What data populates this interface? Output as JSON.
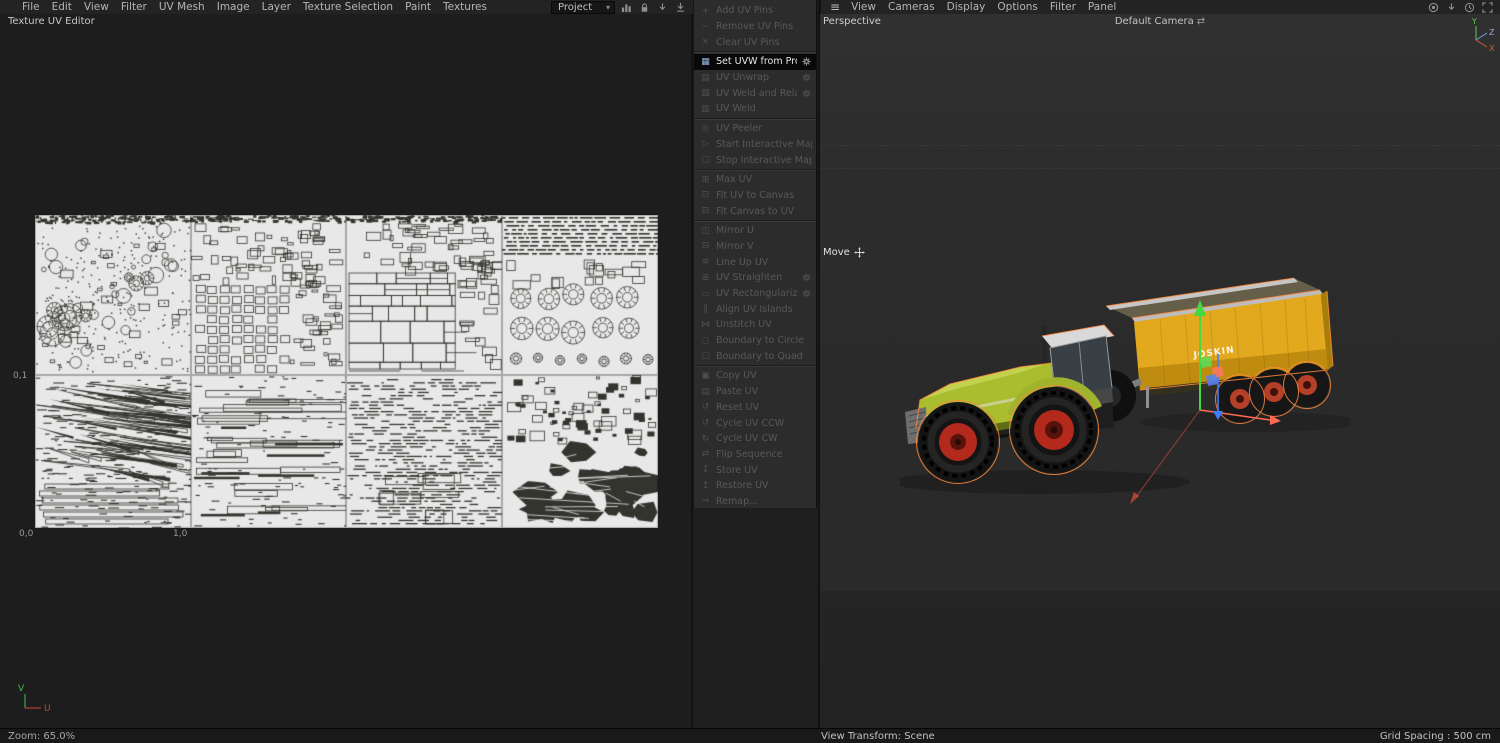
{
  "top_bar": {
    "left_menus": [
      "File",
      "Edit",
      "View",
      "Filter",
      "UV Mesh",
      "Image",
      "Layer",
      "Texture Selection",
      "Paint",
      "Textures"
    ],
    "project_dropdown": "Project",
    "right_menus": [
      "View",
      "Cameras",
      "Display",
      "Options",
      "Filter",
      "Panel"
    ]
  },
  "uv_editor": {
    "title": "Texture UV Editor",
    "zoom_label": "Zoom: 65.0%",
    "coords": {
      "origin": "0,0",
      "u1": "1,0",
      "v1": "0,1"
    },
    "axis": {
      "u": "U",
      "v": "V"
    },
    "tiles": [
      "organic",
      "bricky",
      "quilt",
      "gears",
      "diag",
      "strips",
      "streaks",
      "chunks"
    ]
  },
  "uv_panel": {
    "groups": [
      {
        "items": [
          {
            "label": "Add UV Pins",
            "icon": "pin-add"
          },
          {
            "label": "Remove UV Pins",
            "icon": "pin-remove"
          },
          {
            "label": "Clear UV Pins",
            "icon": "pin-clear"
          }
        ]
      },
      {
        "items": [
          {
            "label": "Set UVW from Projection",
            "icon": "uvw-projection",
            "gear": true,
            "selected": true
          },
          {
            "label": "UV Unwrap",
            "icon": "unwrap",
            "gear": true
          },
          {
            "label": "UV Weld and Relax",
            "icon": "weld-relax",
            "gear": true
          },
          {
            "label": "UV Weld",
            "icon": "weld"
          }
        ]
      },
      {
        "items": [
          {
            "label": "UV Peeler",
            "icon": "peeler"
          },
          {
            "label": "Start Interactive Mapping",
            "icon": "play"
          },
          {
            "label": "Stop Interactive Mapping",
            "icon": "stop"
          }
        ]
      },
      {
        "items": [
          {
            "label": "Max UV",
            "icon": "max"
          },
          {
            "label": "Fit UV to Canvas",
            "icon": "fit-uv"
          },
          {
            "label": "Fit Canvas to UV",
            "icon": "fit-canvas"
          }
        ]
      },
      {
        "items": [
          {
            "label": "Mirror U",
            "icon": "mirror-u"
          },
          {
            "label": "Mirror V",
            "icon": "mirror-v"
          },
          {
            "label": "Line Up UV",
            "icon": "lineup"
          },
          {
            "label": "UV Straighten",
            "icon": "straighten",
            "gear": true
          },
          {
            "label": "UV Rectangularize",
            "icon": "rectangularize",
            "gear": true
          },
          {
            "label": "Align UV Islands",
            "icon": "align"
          },
          {
            "label": "Unstitch UV",
            "icon": "unstitch"
          },
          {
            "label": "Boundary to Circle",
            "icon": "circle"
          },
          {
            "label": "Boundary to Quad",
            "icon": "quad"
          }
        ]
      },
      {
        "items": [
          {
            "label": "Copy UV",
            "icon": "copy"
          },
          {
            "label": "Paste UV",
            "icon": "paste"
          },
          {
            "label": "Reset UV",
            "icon": "reset"
          },
          {
            "label": "Cycle UV CCW",
            "icon": "ccw"
          },
          {
            "label": "Cycle UV CW",
            "icon": "cw"
          },
          {
            "label": "Flip Sequence",
            "icon": "flip"
          },
          {
            "label": "Store UV",
            "icon": "store"
          },
          {
            "label": "Restore UV",
            "icon": "restore"
          },
          {
            "label": "Remap...",
            "icon": "remap"
          }
        ]
      }
    ]
  },
  "viewport": {
    "camera_label": "Perspective",
    "camera_name": "Default Camera",
    "tool_label": "Move",
    "trailer_brand": "JOSKIN",
    "axis": {
      "x": "X",
      "y": "Y",
      "z": "Z"
    },
    "status_left": "View Transform: Scene",
    "status_right": "Grid Spacing : 500 cm"
  },
  "colors": {
    "selection_outline": "#ff8a3c",
    "tractor_green": "#a9bd2f",
    "trailer_yellow": "#e2a81e",
    "rim_red": "#b3291c",
    "axis_x": "#ff5a46",
    "axis_y": "#43d943",
    "axis_z": "#3f7cff",
    "canvas_tile": "#e8e8e8",
    "uv_ink": "#34342f"
  }
}
